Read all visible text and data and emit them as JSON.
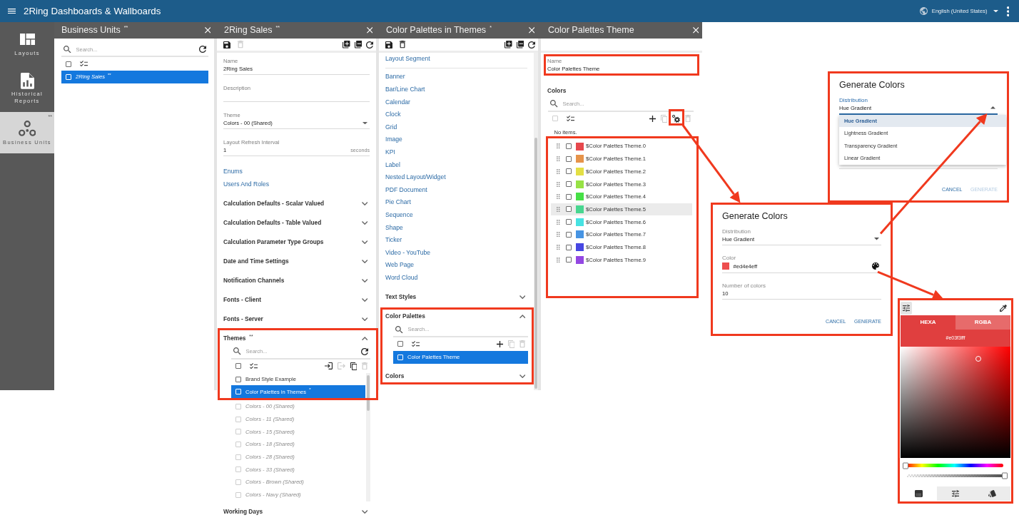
{
  "app_bar": {
    "title": "2Ring Dashboards & Wallboards",
    "language": "English (United States)"
  },
  "side_rail": [
    {
      "kind": "layouts",
      "label": "Layouts",
      "selected": false
    },
    {
      "kind": "reports",
      "label": "Historical Reports",
      "selected": false
    },
    {
      "kind": "units",
      "label": "Business Units",
      "marker": "**",
      "selected": true
    }
  ],
  "panels": [
    {
      "title": "Business Units",
      "marker": "**",
      "body": [
        {
          "kind": "list",
          "search_placeholder": "Search...",
          "search_actions": [
            {
              "kind": "refresh",
              "disabled": false
            }
          ],
          "select_all": {
            "checked": false,
            "disabled": false
          },
          "items": [
            {
              "kind": "italic",
              "label": "2Ring Sales",
              "marker": "**",
              "selected": true,
              "checked": false
            }
          ]
        }
      ]
    },
    {
      "title": "2Ring Sales",
      "marker": "**",
      "body": [
        {
          "kind": "toolbar",
          "left": [
            {
              "kind": "save",
              "disabled": false
            },
            {
              "kind": "delete",
              "disabled": true
            }
          ],
          "right": [
            {
              "kind": "add_copy",
              "disabled": false
            },
            {
              "kind": "remove_copy",
              "disabled": false
            },
            {
              "kind": "refresh",
              "disabled": false
            }
          ]
        },
        {
          "kind": "field",
          "label": "Name",
          "value": "2Ring Sales"
        },
        {
          "kind": "field",
          "label": "Description"
        },
        {
          "kind": "select",
          "label": "Theme",
          "value": "Colors - 00 (Shared)"
        },
        {
          "kind": "field",
          "label": "Layout Refresh Interval",
          "value": "1",
          "suffix": "seconds"
        },
        {
          "kind": "link",
          "label": "Enums"
        },
        {
          "kind": "link",
          "label": "Users And Roles"
        },
        {
          "kind": "section",
          "label": "Calculation Defaults - Scalar Valued",
          "expanded": false,
          "highlighted": false
        },
        {
          "kind": "section",
          "label": "Calculation Defaults - Table Valued",
          "expanded": false,
          "highlighted": false
        },
        {
          "kind": "section",
          "label": "Calculation Parameter Type Groups",
          "expanded": false,
          "highlighted": false
        },
        {
          "kind": "section",
          "label": "Date and Time Settings",
          "expanded": false,
          "highlighted": false
        },
        {
          "kind": "section",
          "label": "Notification Channels",
          "expanded": false,
          "highlighted": false
        },
        {
          "kind": "section",
          "label": "Fonts - Client",
          "expanded": false,
          "highlighted": false
        },
        {
          "kind": "section",
          "label": "Fonts - Server",
          "expanded": false,
          "highlighted": false
        },
        {
          "kind": "section",
          "label": "Themes",
          "marker": "**",
          "expanded": true,
          "highlighted": true,
          "list": {
            "search_placeholder": "Search...",
            "search_actions": [
              {
                "kind": "refresh",
                "disabled": false
              }
            ],
            "select_all": {
              "checked": false,
              "disabled": false
            },
            "actions": [
              {
                "kind": "import",
                "disabled": false
              },
              {
                "kind": "export",
                "disabled": true
              },
              {
                "kind": "copy",
                "disabled": false
              },
              {
                "kind": "delete",
                "disabled": true
              }
            ],
            "scrollbar": true,
            "items": [
              {
                "kind": "plain",
                "label": "Brand Style Example",
                "selected": false,
                "checked": false
              },
              {
                "kind": "plain",
                "label": "Color Palettes in Themes",
                "marker": "*",
                "selected": true,
                "checked": false
              },
              {
                "kind": "italic",
                "label": "Colors - 00 (Shared)",
                "selected": false,
                "checked": false
              },
              {
                "kind": "italic",
                "label": "Colors - 11 (Shared)",
                "selected": false,
                "checked": false
              },
              {
                "kind": "italic",
                "label": "Colors - 15 (Shared)",
                "selected": false,
                "checked": false
              },
              {
                "kind": "italic",
                "label": "Colors - 18 (Shared)",
                "selected": false,
                "checked": false
              },
              {
                "kind": "italic",
                "label": "Colors - 28 (Shared)",
                "selected": false,
                "checked": false
              },
              {
                "kind": "italic",
                "label": "Colors - 33 (Shared)",
                "selected": false,
                "checked": false
              },
              {
                "kind": "italic",
                "label": "Colors - Brown (Shared)",
                "selected": false,
                "checked": false
              },
              {
                "kind": "italic",
                "label": "Colors - Navy (Shared)",
                "selected": false,
                "checked": false
              }
            ]
          }
        },
        {
          "kind": "section",
          "label": "Working Days",
          "expanded": false,
          "highlighted": false
        }
      ]
    },
    {
      "title": "Color Palettes in Themes",
      "marker": "*",
      "scrollbar": true,
      "body": [
        {
          "kind": "toolbar",
          "left": [
            {
              "kind": "save",
              "disabled": false
            },
            {
              "kind": "delete",
              "disabled": false
            }
          ],
          "right": [
            {
              "kind": "add_copy",
              "disabled": false
            },
            {
              "kind": "remove_copy",
              "disabled": false
            },
            {
              "kind": "refresh",
              "disabled": false
            }
          ]
        },
        {
          "kind": "link",
          "label": "Layout Segment"
        },
        {
          "kind": "divider"
        },
        {
          "kind": "link",
          "label": "Banner"
        },
        {
          "kind": "link",
          "label": "Bar/Line Chart"
        },
        {
          "kind": "link",
          "label": "Calendar"
        },
        {
          "kind": "link",
          "label": "Clock"
        },
        {
          "kind": "link",
          "label": "Grid"
        },
        {
          "kind": "link",
          "label": "Image"
        },
        {
          "kind": "link",
          "label": "KPI"
        },
        {
          "kind": "link",
          "label": "Label"
        },
        {
          "kind": "link",
          "label": "Nested Layout/Widget"
        },
        {
          "kind": "link",
          "label": "PDF Document"
        },
        {
          "kind": "link",
          "label": "Pie Chart"
        },
        {
          "kind": "link",
          "label": "Sequence"
        },
        {
          "kind": "link",
          "label": "Shape"
        },
        {
          "kind": "link",
          "label": "Ticker"
        },
        {
          "kind": "link",
          "label": "Video - YouTube"
        },
        {
          "kind": "link",
          "label": "Web Page"
        },
        {
          "kind": "link",
          "label": "Word Cloud"
        },
        {
          "kind": "section",
          "label": "Text Styles",
          "expanded": false,
          "highlighted": false
        },
        {
          "kind": "section",
          "label": "Color Palettes",
          "expanded": true,
          "highlighted": true,
          "list": {
            "search_placeholder": "Search...",
            "select_all": {
              "checked": false,
              "disabled": false
            },
            "actions": [
              {
                "kind": "add",
                "disabled": false
              },
              {
                "kind": "copy",
                "disabled": true
              },
              {
                "kind": "delete",
                "disabled": true
              }
            ],
            "items": [
              {
                "kind": "plain",
                "label": "Color Palettes Theme",
                "selected": true,
                "checked": false
              }
            ]
          }
        },
        {
          "kind": "section",
          "label": "Colors",
          "expanded": false,
          "highlighted": true
        }
      ]
    },
    {
      "title": "Color Palettes Theme",
      "body": [
        {
          "kind": "toolbar"
        },
        {
          "kind": "field",
          "label": "Name",
          "value": "Color Palettes Theme",
          "highlighted": true
        },
        {
          "kind": "heading",
          "label": "Colors"
        },
        {
          "kind": "color_list",
          "search_placeholder": "Search...",
          "select_all": {
            "checked": false,
            "disabled": true
          },
          "actions": [
            {
              "kind": "add",
              "disabled": false
            },
            {
              "kind": "copy",
              "disabled": true
            },
            {
              "kind": "generate",
              "disabled": false,
              "highlighted": true
            },
            {
              "kind": "delete",
              "disabled": true
            }
          ],
          "note": "No items.",
          "highlighted": true,
          "items": [
            {
              "label": "$Color Palettes Theme.0",
              "color": "#e6484d",
              "checked": false,
              "hovered": false
            },
            {
              "label": "$Color Palettes Theme.1",
              "color": "#e6934a",
              "checked": false,
              "hovered": false
            },
            {
              "label": "$Color Palettes Theme.2",
              "color": "#e3df44",
              "checked": false,
              "hovered": false
            },
            {
              "label": "$Color Palettes Theme.3",
              "color": "#97e245",
              "checked": false,
              "hovered": false
            },
            {
              "label": "$Color Palettes Theme.4",
              "color": "#46e046",
              "checked": false,
              "hovered": false
            },
            {
              "label": "$Color Palettes Theme.5",
              "color": "#48d690",
              "checked": false,
              "hovered": true
            },
            {
              "label": "$Color Palettes Theme.6",
              "color": "#47e2e2",
              "checked": false,
              "hovered": false
            },
            {
              "label": "$Color Palettes Theme.7",
              "color": "#4794e3",
              "checked": false,
              "hovered": false
            },
            {
              "label": "$Color Palettes Theme.8",
              "color": "#4747e2",
              "checked": false,
              "hovered": false
            },
            {
              "label": "$Color Palettes Theme.9",
              "color": "#9347e2",
              "checked": false,
              "hovered": false
            }
          ]
        }
      ]
    }
  ],
  "callouts": [
    {
      "kind": "generate_dialog",
      "title": "Generate Colors",
      "highlighted": true,
      "fields": [
        {
          "kind": "select",
          "label": "Distribution",
          "value": "Hue Gradient",
          "open": true,
          "options": [
            {
              "label": "Hue Gradient",
              "selected": true
            },
            {
              "label": "Lightness Gradient",
              "selected": false
            },
            {
              "label": "Transparency Gradient",
              "selected": false
            },
            {
              "label": "Linear Gradient",
              "selected": false
            }
          ]
        },
        {
          "kind": "divider"
        }
      ],
      "buttons": [
        {
          "label": "CANCEL",
          "disabled": false
        },
        {
          "label": "GENERATE",
          "disabled": true
        }
      ]
    },
    {
      "kind": "generate_dialog",
      "title": "Generate Colors",
      "highlighted": true,
      "fields": [
        {
          "kind": "select",
          "label": "Distribution",
          "value": "Hue Gradient",
          "open": false
        },
        {
          "kind": "color",
          "label": "Color",
          "value": "#ed4e4eff"
        },
        {
          "kind": "text",
          "label": "Number of colors",
          "value": "10"
        }
      ],
      "buttons": [
        {
          "label": "CANCEL",
          "disabled": false
        },
        {
          "label": "GENERATE",
          "disabled": false
        }
      ]
    },
    {
      "kind": "color_picker",
      "highlighted": true,
      "tabs": [
        {
          "label": "HEXA",
          "selected": true
        },
        {
          "label": "RGBA",
          "selected": false
        }
      ],
      "value": "#e03f3fff",
      "hue": {
        "level": 0
      },
      "alpha": {
        "level": 1
      },
      "modes": [
        {
          "kind": "swatches",
          "selected": true
        },
        {
          "kind": "sliders",
          "selected": false
        },
        {
          "kind": "styles",
          "selected": false
        }
      ]
    }
  ]
}
